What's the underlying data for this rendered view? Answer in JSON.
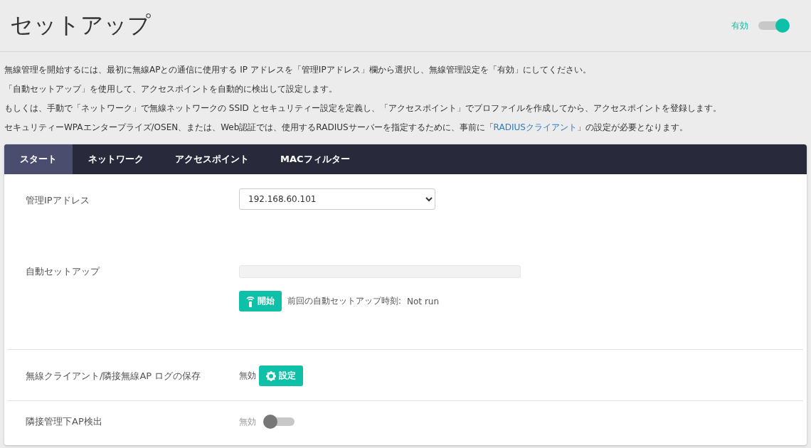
{
  "header": {
    "title": "セットアップ",
    "toggle": {
      "label": "有効",
      "on": true
    }
  },
  "description": [
    "無線管理を開始するには、最初に無線APとの通信に使用する IP アドレスを「管理IPアドレス」欄から選択し、無線管理設定を「有効」にしてください。",
    "「自動セットアップ」を使用して、アクセスポイントを自動的に検出して設定します。",
    "もしくは、手動で「ネットワーク」で無線ネットワークの SSID とセキュリティー設定を定義し、「アクセスポイント」でプロファイルを作成してから、アクセスポイントを登録します。"
  ],
  "note": {
    "before": "セキュリティーWPAエンタープライズ/OSEN、または、Web認証では、使用するRADIUSサーバーを指定するために、事前に「",
    "link": "RADIUSクライアント",
    "after": "」の設定が必要となります。"
  },
  "tabs": [
    {
      "label": "スタート",
      "selected": true
    },
    {
      "label": "ネットワーク",
      "selected": false
    },
    {
      "label": "アクセスポイント",
      "selected": false
    },
    {
      "label": "MACフィルター",
      "selected": false
    }
  ],
  "rows": [
    {
      "kind": "select",
      "label": "管理IPアドレス",
      "value": "192.168.60.101"
    },
    {
      "kind": "progress",
      "label": "自動セットアップ",
      "level": 0,
      "button": "開始",
      "last_run_label": "前回の自動セットアップ時刻:",
      "last_run": "Not run"
    },
    {
      "kind": "setting",
      "label": "無線クライアント/隣接無線AP ログの保存",
      "status": "無効",
      "button": "設定"
    },
    {
      "kind": "toggle",
      "label": "隣接管理下AP検出",
      "toggle": {
        "label": "無効",
        "on": false
      }
    }
  ]
}
